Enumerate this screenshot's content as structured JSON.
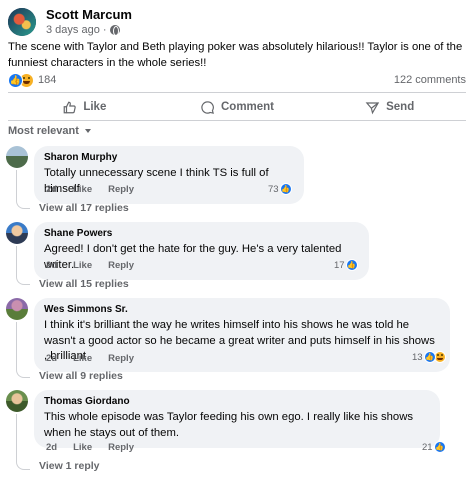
{
  "post": {
    "author": "Scott Marcum",
    "time": "3 days ago",
    "meta_sep": "·",
    "more_icon": "more-icon",
    "text": "The scene with Taylor and Beth playing poker was absolutely hilarious!! Taylor is one of the funniest characters in the whole series!!",
    "reaction_count": "184",
    "comment_count": "122 comments"
  },
  "actions": {
    "like": "Like",
    "comment": "Comment",
    "send": "Send"
  },
  "sort_label": "Most relevant",
  "comments": [
    {
      "name": "Sharon Murphy",
      "text": "Totally unnecessary scene I think TS is full of himself",
      "time": "2d",
      "like": "Like",
      "reply": "Reply",
      "reactions": "73",
      "view_replies": "View all 17 replies"
    },
    {
      "name": "Shane Powers",
      "text": "Agreed! I don't get the hate for the guy. He's a very talented writer.",
      "time": "2d",
      "like": "Like",
      "reply": "Reply",
      "reactions": "17",
      "view_replies": "View all 15 replies"
    },
    {
      "name": "Wes Simmons Sr.",
      "text": "I think it's brilliant the way he writes himself into his shows he was told he wasn't a good actor so he became a great writer and puts himself in his shows , brilliant",
      "time": "2d",
      "like": "Like",
      "reply": "Reply",
      "reactions": "13",
      "view_replies": "View all 9 replies"
    },
    {
      "name": "Thomas Giordano",
      "text": "This whole episode was Taylor feeding his own ego. I really like his shows when he stays out of them.",
      "time": "2d",
      "like": "Like",
      "reply": "Reply",
      "reactions": "21",
      "view_replies": "View 1 reply"
    }
  ],
  "colors": {
    "like_blue": "#1877f2",
    "bubble_bg": "#f0f2f5",
    "secondary_text": "#65676b"
  }
}
